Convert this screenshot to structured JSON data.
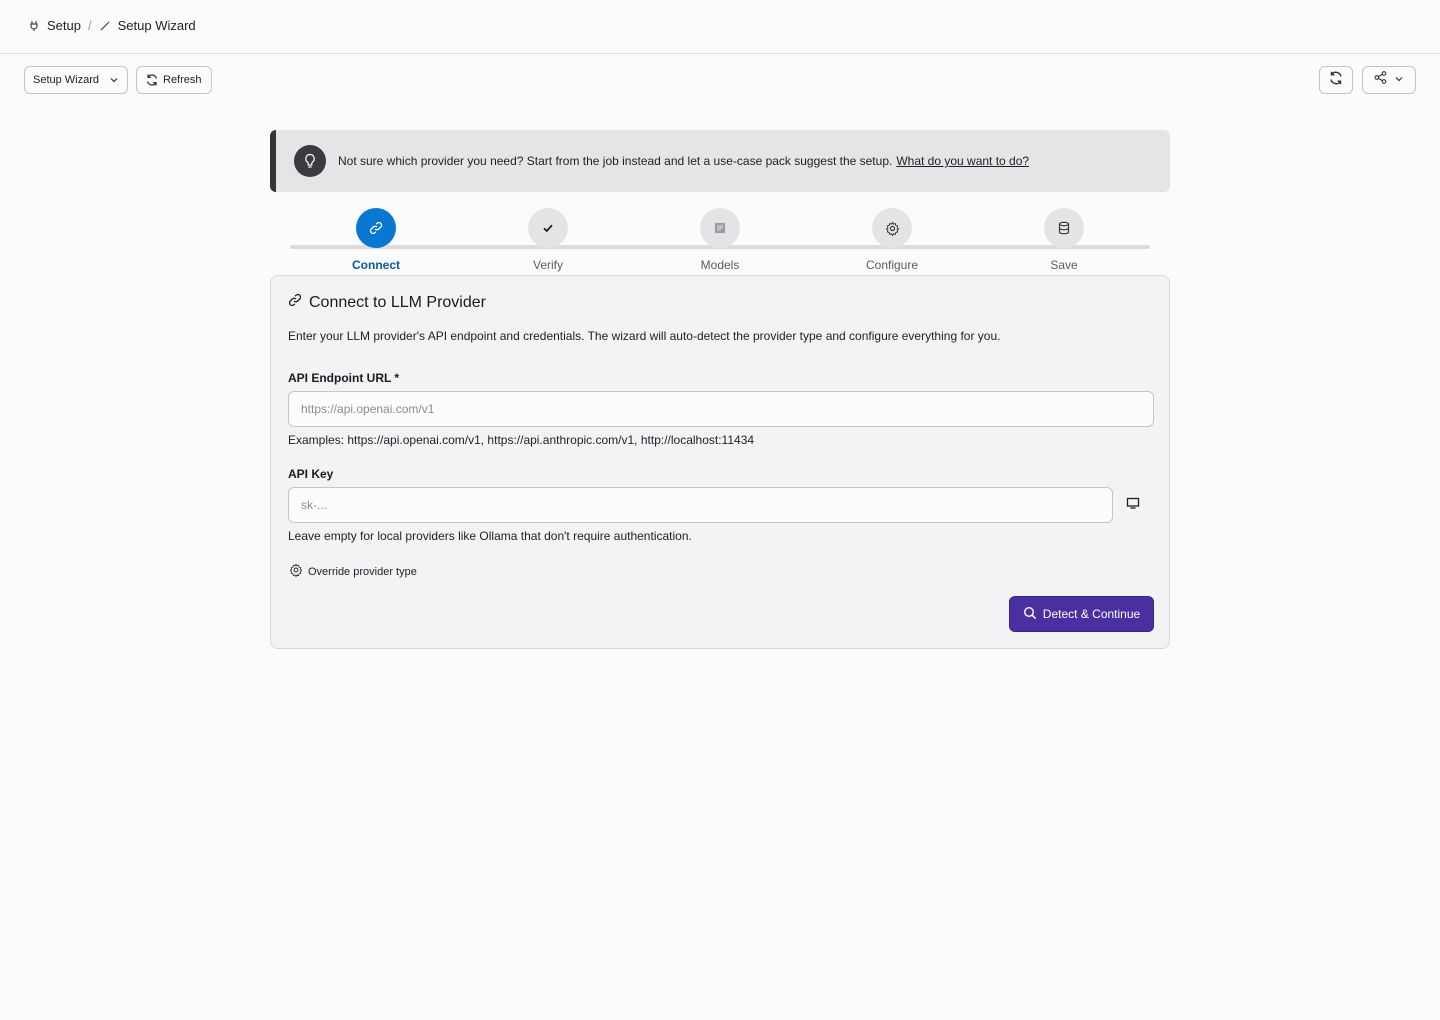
{
  "breadcrumb": {
    "items": [
      {
        "label": "Setup",
        "icon": "plug-icon"
      },
      {
        "label": "Setup Wizard",
        "icon": "wand-icon"
      }
    ],
    "separator": "/"
  },
  "toolbar": {
    "view_select": "Setup Wizard",
    "refresh_label": "Refresh",
    "right_icons": [
      "sync-icon",
      "share-icon",
      "chevron-down-icon"
    ]
  },
  "banner": {
    "icon": "lightbulb-icon",
    "text": "Not sure which provider you need? Start from the job instead and let a use-case pack suggest the setup.",
    "link": "What do you want to do?"
  },
  "stepper": {
    "active_index": 0,
    "steps": [
      {
        "label": "Connect",
        "icon": "link-icon"
      },
      {
        "label": "Verify",
        "icon": "check-icon"
      },
      {
        "label": "Models",
        "icon": "models-icon"
      },
      {
        "label": "Configure",
        "icon": "gear-icon"
      },
      {
        "label": "Save",
        "icon": "database-icon"
      }
    ]
  },
  "card": {
    "title": "Connect to LLM Provider",
    "description": "Enter your LLM provider's API endpoint and credentials. The wizard will auto-detect the provider type and configure everything for you.",
    "endpoint": {
      "label": "API Endpoint URL *",
      "value": "",
      "placeholder": "https://api.openai.com/v1",
      "help": "Examples: https://api.openai.com/v1, https://api.anthropic.com/v1, http://localhost:11434"
    },
    "api_key": {
      "label": "API Key",
      "value": "",
      "placeholder": "sk-...",
      "help": "Leave empty for local providers like Ollama that don't require authentication."
    },
    "override_label": "Override provider type",
    "primary_button": "Detect & Continue"
  },
  "colors": {
    "accent_step": "#0a78d2",
    "primary_button": "#4a2fa1",
    "banner_bg": "#e5e5e7"
  }
}
